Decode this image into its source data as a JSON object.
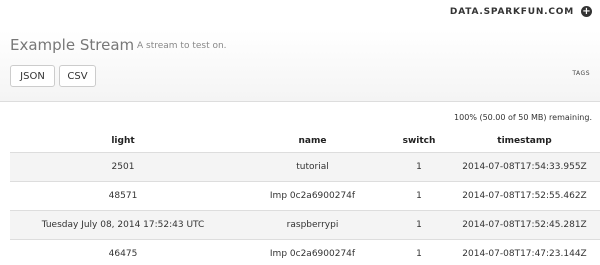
{
  "topbar": {
    "brand": "DATA.SPARKFUN.COM",
    "plus_icon": "plus-circle-icon"
  },
  "stream": {
    "title": "Example Stream",
    "description": "A stream to test on."
  },
  "exports": {
    "json_label": "JSON",
    "csv_label": "CSV"
  },
  "tags_label": "TAGS",
  "remaining": "100% (50.00 of 50 MB) remaining.",
  "table": {
    "headers": [
      "light",
      "name",
      "switch",
      "timestamp"
    ],
    "rows": [
      [
        "2501",
        "tutorial",
        "1",
        "2014-07-08T17:54:33.955Z"
      ],
      [
        "48571",
        "Imp 0c2a6900274f",
        "1",
        "2014-07-08T17:52:55.462Z"
      ],
      [
        "Tuesday July 08, 2014 17:52:43 UTC",
        "raspberrypi",
        "1",
        "2014-07-08T17:52:45.281Z"
      ],
      [
        "46475",
        "Imp 0c2a6900274f",
        "1",
        "2014-07-08T17:47:23.144Z"
      ]
    ]
  }
}
